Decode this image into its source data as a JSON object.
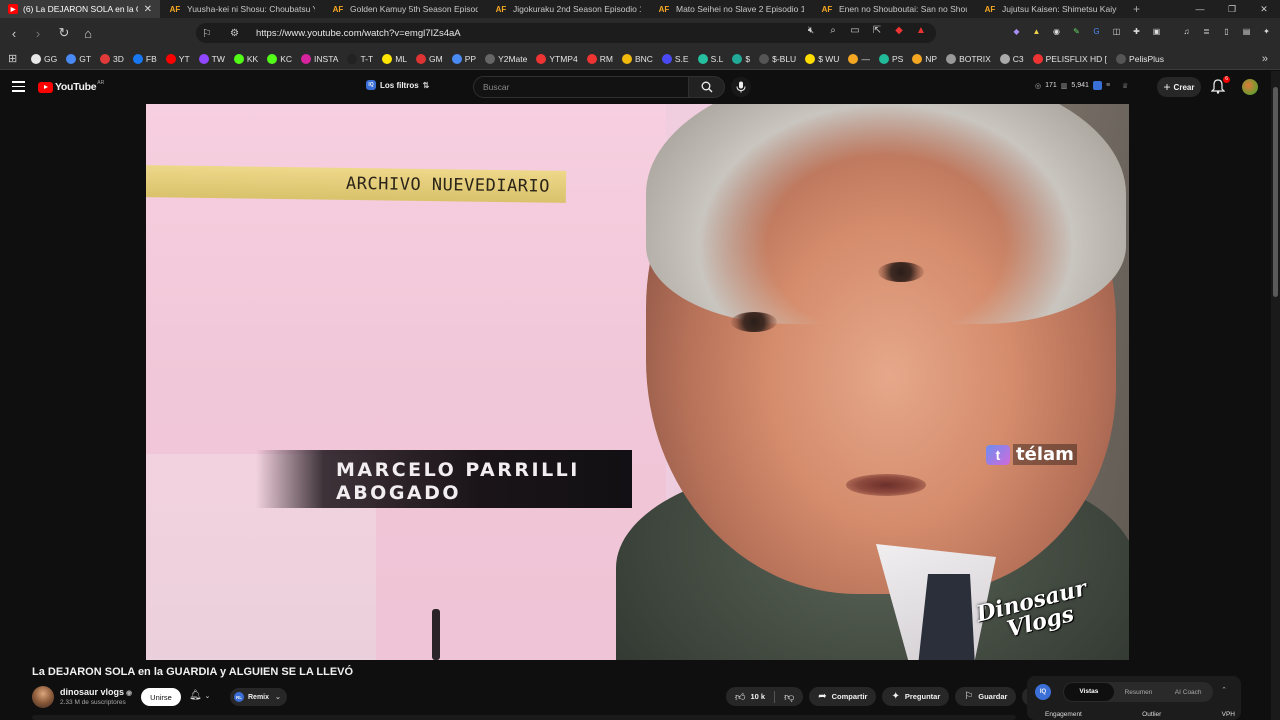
{
  "browser": {
    "tabs": [
      {
        "icon": "youtube-favicon",
        "title": "(6) La DEJARON SOLA en la G",
        "active": true
      },
      {
        "icon": "animeflv-favicon",
        "title": "Yuusha-kei ni Shosu: Choubatsu Yu"
      },
      {
        "icon": "animeflv-favicon",
        "title": "Golden Kamuy 5th Season Episodio"
      },
      {
        "icon": "animeflv-favicon",
        "title": "Jigokuraku 2nd Season Episodio 1 S"
      },
      {
        "icon": "animeflv-favicon",
        "title": "Mato Seihei no Slave 2 Episodio 1 S"
      },
      {
        "icon": "animeflv-favicon",
        "title": "Enen no Shouboutai: San no Shou E"
      },
      {
        "icon": "animeflv-favicon",
        "title": "Jujutsu Kaisen: Shimetsu Kaiyuu - Ze"
      }
    ],
    "af_label": "AF",
    "close_glyph": "✕",
    "new_tab_glyph": "+",
    "url": "https://www.youtube.com/watch?v=emgl7IZs4aA",
    "bookmarks": [
      {
        "label": "GG",
        "color": "#e8e8e8"
      },
      {
        "label": "GT",
        "color": "#4a8af4"
      },
      {
        "label": "3D",
        "color": "#e03a3a"
      },
      {
        "label": "FB",
        "color": "#1877f2"
      },
      {
        "label": "YT",
        "color": "#ff0000"
      },
      {
        "label": "TW",
        "color": "#9146ff"
      },
      {
        "label": "KK",
        "color": "#53fc18"
      },
      {
        "label": "KC",
        "color": "#53fc18"
      },
      {
        "label": "INSTA",
        "color": "#d6249f"
      },
      {
        "label": "T-T",
        "color": "#222222"
      },
      {
        "label": "ML",
        "color": "#ffe600"
      },
      {
        "label": "GM",
        "color": "#d33"
      },
      {
        "label": "PP",
        "color": "#4a8af4"
      },
      {
        "label": "Y2Mate",
        "color": "#666666"
      },
      {
        "label": "YTMP4",
        "color": "#e33"
      },
      {
        "label": "RM",
        "color": "#e33"
      },
      {
        "label": "BNC",
        "color": "#f0b90b"
      },
      {
        "label": "S.E",
        "color": "#4a4af4"
      },
      {
        "label": "S.L",
        "color": "#25c0a0"
      },
      {
        "label": "$",
        "color": "#2a9"
      },
      {
        "label": "$-BLU",
        "color": "#555555"
      },
      {
        "label": "$ WU",
        "color": "#ffdd00"
      },
      {
        "label": "—",
        "color": "#f5a623"
      },
      {
        "label": "PS",
        "color": "#2b9"
      },
      {
        "label": "NP",
        "color": "#f5a623"
      },
      {
        "label": "BOTRIX",
        "color": "#999999"
      },
      {
        "label": "C3",
        "color": "#aaaaaa"
      },
      {
        "label": "PELISFLIX HD [",
        "color": "#e33"
      },
      {
        "label": "PelisPlus",
        "color": "#555555"
      }
    ]
  },
  "youtube": {
    "logo_text": "YouTube",
    "logo_region": "AR",
    "filters_label": "Los filtros",
    "filters_badge": "IQ",
    "search_placeholder": "Buscar",
    "stats": {
      "a": "171",
      "b": "5,941"
    },
    "create_label": "Crear",
    "notifications_count": "6"
  },
  "video": {
    "archive_tag": "ARCHIVO NUEVEDIARIO",
    "name_line1": "MARCELO PARRILLI",
    "name_line2": "ABOGADO",
    "telam_mark": "t",
    "telam_word": "télam",
    "watermark_line1": "Dinosaur",
    "watermark_line2": "Vlogs"
  },
  "below": {
    "title": "La DEJARON SOLA en la GUARDIA y ALGUIEN SE LA LLEVÓ",
    "channel_name": "dinosaur vlogs",
    "verified_glyph": "◉",
    "subscribers": "2.33 M de suscriptores",
    "join_label": "Unirse",
    "remix_label": "Remix",
    "remix_badge": "RL",
    "likes": "10 k",
    "share_label": "Compartir",
    "ask_label": "Preguntar",
    "save_label": "Guardar"
  },
  "panel": {
    "badge": "IQ",
    "tabs": [
      "Vistas",
      "Resumen",
      "AI Coach"
    ],
    "labels": [
      "Engagement",
      "Outlier",
      "VPH"
    ]
  }
}
